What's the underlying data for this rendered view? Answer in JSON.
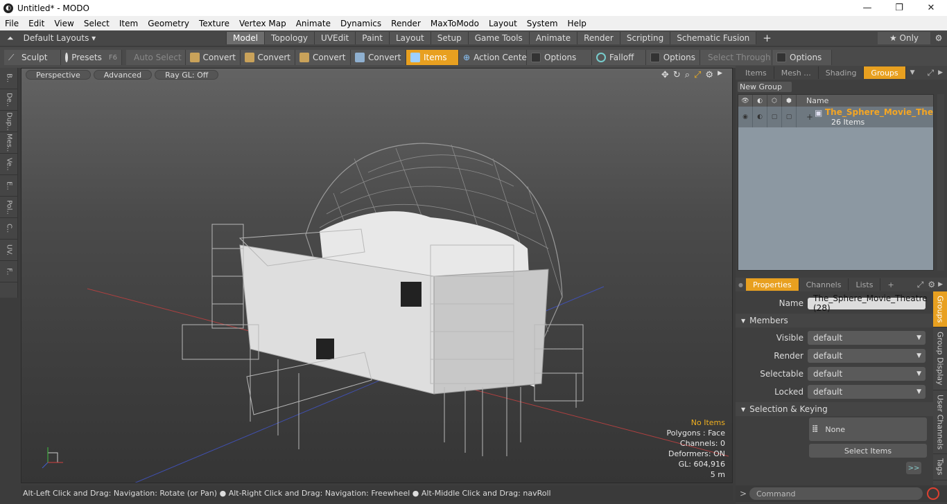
{
  "window": {
    "title": "Untitled* - MODO",
    "minimize": "—",
    "restore": "❐",
    "close": "✕"
  },
  "menu": [
    "File",
    "Edit",
    "View",
    "Select",
    "Item",
    "Geometry",
    "Texture",
    "Vertex Map",
    "Animate",
    "Dynamics",
    "Render",
    "MaxToModo",
    "Layout",
    "System",
    "Help"
  ],
  "layoutbar": {
    "layout_label": "Default Layouts ▾",
    "tabs": [
      "Model",
      "Topology",
      "UVEdit",
      "Paint",
      "Layout",
      "Setup",
      "Game Tools",
      "Animate",
      "Render",
      "Scripting",
      "Schematic Fusion"
    ],
    "active_tab": "Model",
    "add": "+",
    "only": "★  Only",
    "gear": "⚙"
  },
  "toolbar": {
    "sculpt": "Sculpt",
    "presets": "Presets",
    "presets_key": "F6",
    "auto_select": "Auto Select",
    "convert1": "Convert",
    "convert2": "Convert",
    "convert3": "Convert",
    "convert4": "Convert",
    "items": "Items",
    "action_center": "Action Center",
    "options1": "Options",
    "falloff": "Falloff",
    "options2": "Options",
    "select_through": "Select Through",
    "options3": "Options"
  },
  "leftstrip": [
    "B..",
    "De..",
    "Dup..",
    "Mes..",
    "Ve..",
    "E..",
    "Pol..",
    "C..",
    "UV.",
    "F.."
  ],
  "viewport": {
    "perspective": "Perspective",
    "advanced": "Advanced",
    "raygl": "Ray GL: Off"
  },
  "hud": {
    "selection": "No Items",
    "polygons": "Polygons : Face",
    "channels": "Channels: 0",
    "deformers": "Deformers: ON",
    "gl": "GL: 604,916",
    "scale": "5 m"
  },
  "status": "Alt-Left Click and Drag: Navigation: Rotate (or Pan) ● Alt-Right Click and Drag: Navigation: Freewheel ● Alt-Middle Click and Drag: navRoll",
  "groups_panel": {
    "tabs": [
      "Items",
      "Mesh ...",
      "Shading",
      "Groups"
    ],
    "active": "Groups",
    "new_group": "New Group",
    "col_name": "Name",
    "group_name": "The_Sphere_Movie_Thea...",
    "group_count": "26 Items"
  },
  "properties": {
    "tabs": [
      "Properties",
      "Channels",
      "Lists"
    ],
    "add": "+",
    "name_label": "Name",
    "name_value": "The_Sphere_Movie_Theatre (28)",
    "members": "Members",
    "visible_label": "Visible",
    "visible": "default",
    "render_label": "Render",
    "render": "default",
    "selectable_label": "Selectable",
    "selectable": "default",
    "locked_label": "Locked",
    "locked": "default",
    "sel_keying": "Selection & Keying",
    "none": "None",
    "select_items": "Select Items",
    "more": ">>"
  },
  "sidetabs": [
    "Groups",
    "Group Display",
    "User Channels",
    "Tags"
  ],
  "command": {
    "placeholder": "Command",
    "prompt": ">"
  }
}
